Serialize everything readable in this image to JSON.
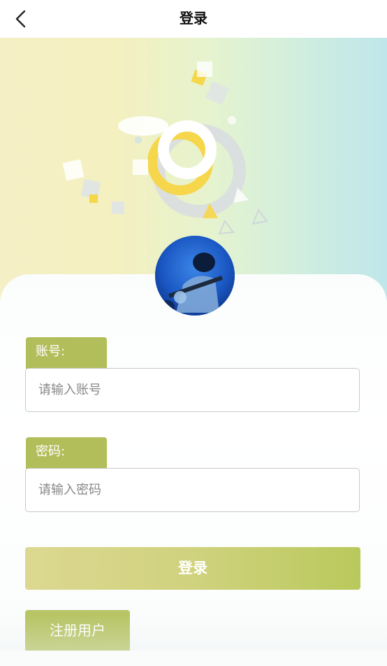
{
  "nav": {
    "title": "登录",
    "back_icon": "chevron-left-icon"
  },
  "form": {
    "account_label": "账号:",
    "account_placeholder": "请输入账号",
    "password_label": "密码:",
    "password_placeholder": "请输入密码"
  },
  "actions": {
    "login_label": "登录",
    "register_label": "注册用户"
  },
  "colors": {
    "label_tab": "#b2be5a",
    "login_gradient_start": "#dcd891",
    "login_gradient_end": "#b9c95c",
    "register": "#b8c566"
  }
}
